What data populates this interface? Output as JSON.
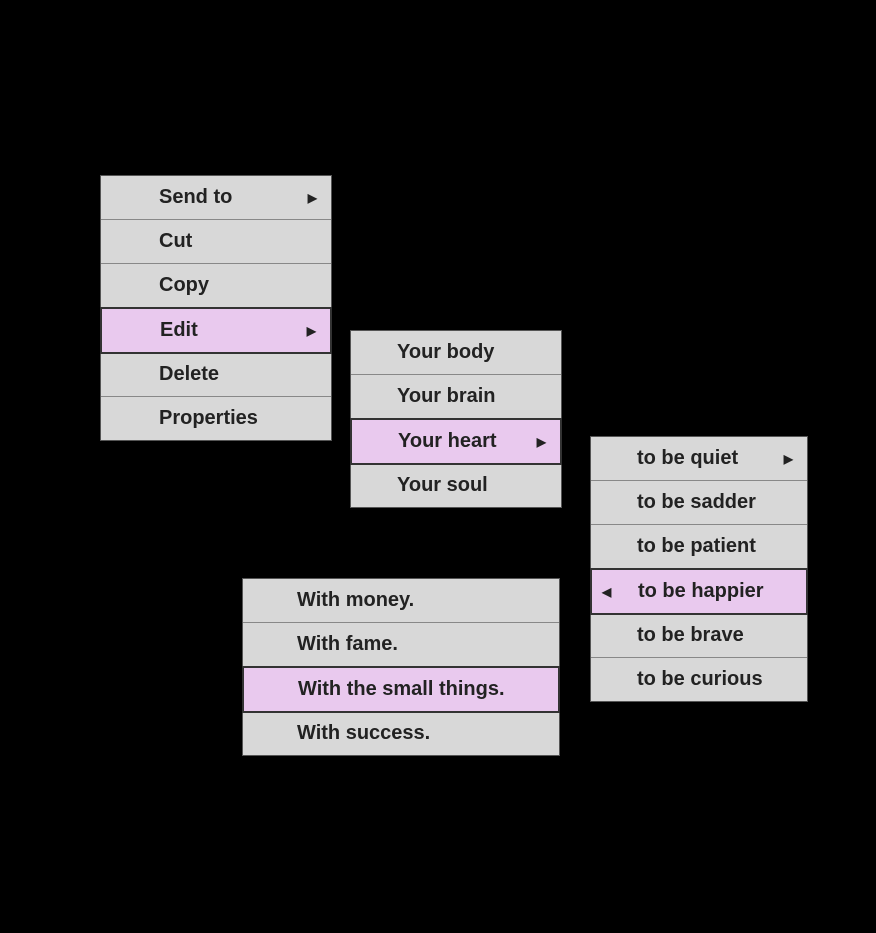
{
  "menu1": {
    "items": [
      {
        "label": "Send to",
        "arrow": "right",
        "highlight": false
      },
      {
        "label": "Cut",
        "arrow": null,
        "highlight": false
      },
      {
        "label": "Copy",
        "arrow": null,
        "highlight": false
      },
      {
        "label": "Edit",
        "arrow": "right",
        "highlight": true
      },
      {
        "label": "Delete",
        "arrow": null,
        "highlight": false
      },
      {
        "label": "Properties",
        "arrow": null,
        "highlight": false
      }
    ]
  },
  "menu2": {
    "items": [
      {
        "label": "Your body",
        "arrow": null,
        "highlight": false
      },
      {
        "label": "Your brain",
        "arrow": null,
        "highlight": false
      },
      {
        "label": "Your heart",
        "arrow": "right",
        "highlight": true
      },
      {
        "label": "Your soul",
        "arrow": null,
        "highlight": false
      }
    ]
  },
  "menu3": {
    "items": [
      {
        "label": "to be quiet",
        "arrow": "right",
        "highlight": false
      },
      {
        "label": "to be sadder",
        "arrow": null,
        "highlight": false
      },
      {
        "label": "to be patient",
        "arrow": null,
        "highlight": false
      },
      {
        "label": "to be happier",
        "arrow": "left",
        "highlight": true
      },
      {
        "label": "to be brave",
        "arrow": null,
        "highlight": false
      },
      {
        "label": "to be curious",
        "arrow": null,
        "highlight": false
      }
    ]
  },
  "menu4": {
    "items": [
      {
        "label": "With money.",
        "arrow": null,
        "highlight": false
      },
      {
        "label": "With fame.",
        "arrow": null,
        "highlight": false
      },
      {
        "label": "With the small things.",
        "arrow": null,
        "highlight": true
      },
      {
        "label": "With success.",
        "arrow": null,
        "highlight": false
      }
    ]
  }
}
